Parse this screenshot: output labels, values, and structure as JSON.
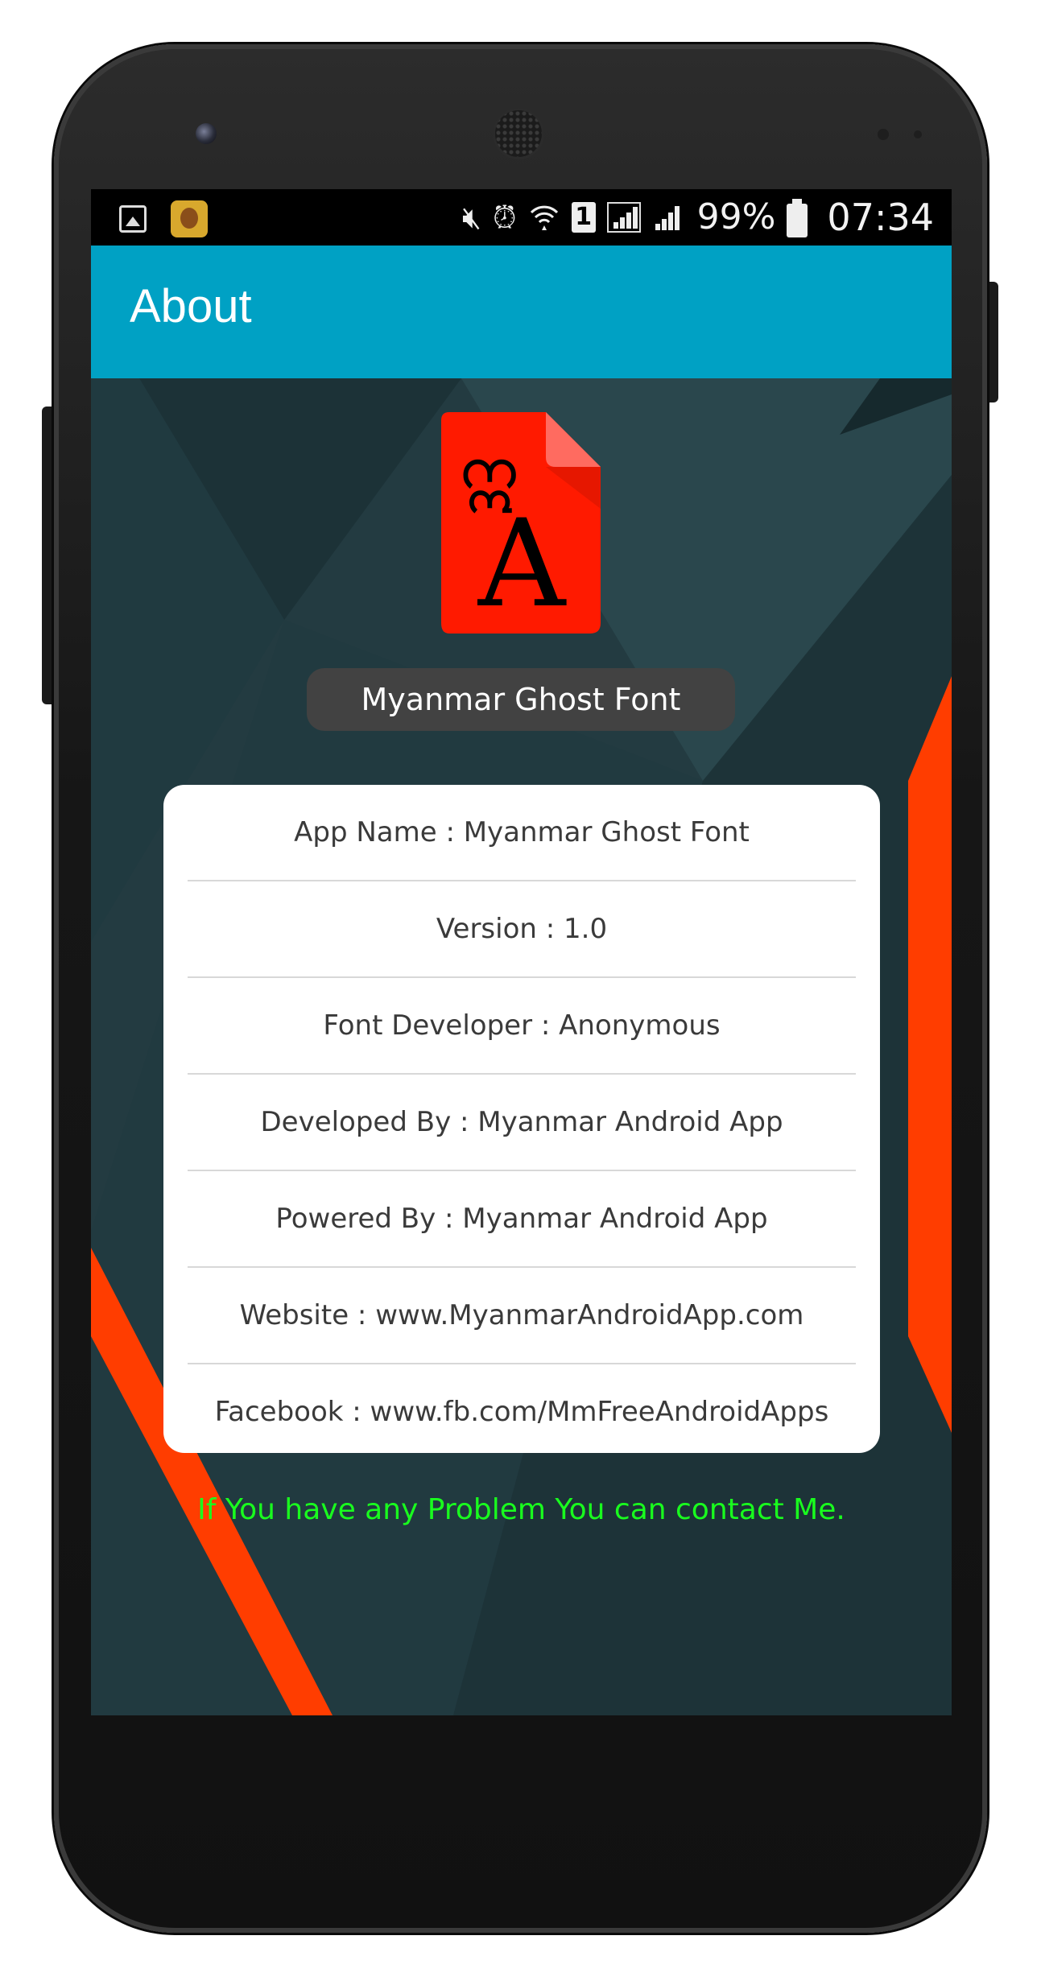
{
  "status_bar": {
    "battery_percent": "99%",
    "time": "07:34",
    "sim_slot": "1",
    "icons": [
      "gallery-icon",
      "app-notification-icon",
      "mute-icon",
      "alarm-icon",
      "wifi-icon",
      "sim-icon",
      "signal-icon",
      "signal-icon-2",
      "battery-icon"
    ]
  },
  "app_bar": {
    "title": "About"
  },
  "app_logo": {
    "glyph_top": "ဣ",
    "glyph_bottom": "A"
  },
  "app_title": "Myanmar Ghost Font",
  "info": [
    {
      "label": "App Name : Myanmar Ghost Font"
    },
    {
      "label": "Version : 1.0"
    },
    {
      "label": "Font Developer : Anonymous"
    },
    {
      "label": "Developed By : Myanmar Android App"
    },
    {
      "label": "Powered By : Myanmar Android App"
    },
    {
      "label": "Website : www.MyanmarAndroidApp.com"
    },
    {
      "label": "Facebook : www.fb.com/MmFreeAndroidApps"
    }
  ],
  "contact_message": "If You have any Problem You can contact Me.",
  "colors": {
    "app_bar": "#00a1c4",
    "content_bg": "#233b41",
    "accent_orange": "#ff3d00",
    "logo_red": "#ff1a00",
    "contact_text": "#19ff1e"
  }
}
